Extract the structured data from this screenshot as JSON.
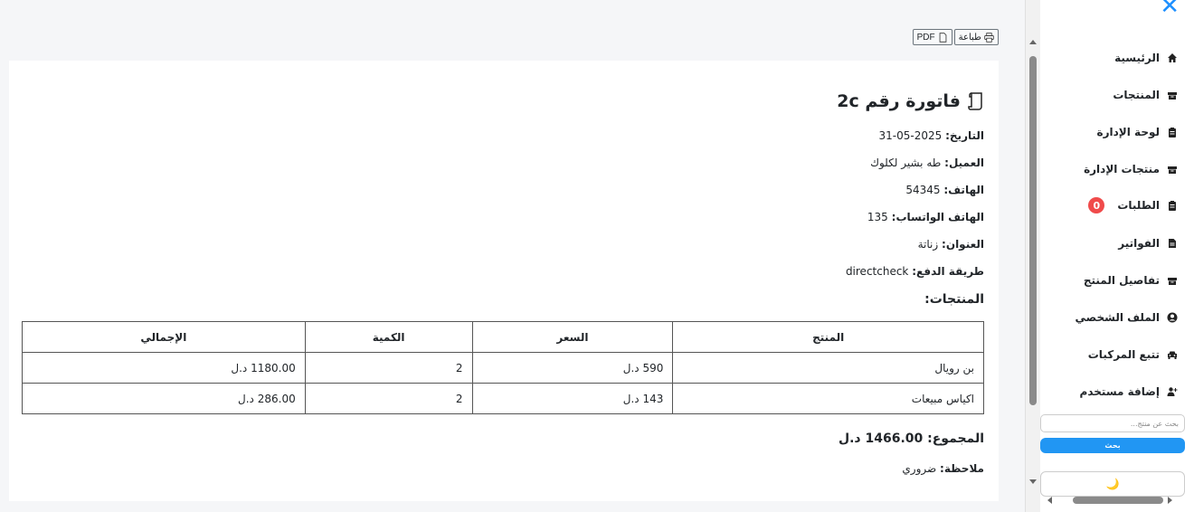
{
  "toolbar": {
    "print_label": "طباعة",
    "pdf_label": "PDF"
  },
  "invoice": {
    "title": "فاتورة رقم 2c",
    "fields": [
      {
        "label": "التاريخ:",
        "value": "2025-05-31"
      },
      {
        "label": "العميل:",
        "value": "طه بشير لكلوك"
      },
      {
        "label": "الهاتف:",
        "value": "54345"
      },
      {
        "label": "الهاتف الواتساب:",
        "value": "135"
      },
      {
        "label": "العنوان:",
        "value": "زناتة"
      },
      {
        "label": "طريقة الدفع:",
        "value": "directcheck"
      }
    ],
    "products_heading": "المنتجات:",
    "table": {
      "headers": [
        "المنتج",
        "السعر",
        "الكمية",
        "الإجمالي"
      ],
      "rows": [
        [
          "بن رويال",
          "590 د.ل",
          "2",
          "1180.00 د.ل"
        ],
        [
          "اكياس مبيعات",
          "143 د.ل",
          "2",
          "286.00 د.ل"
        ]
      ]
    },
    "total_label": "المجموع:",
    "total_value": "1466.00 د.ل",
    "note_label": "ملاحظة:",
    "note_value": "ضروري"
  },
  "sidebar": {
    "close_icon": "✕",
    "items": [
      {
        "label": "الرئيسية",
        "icon": "home-icon"
      },
      {
        "label": "المنتجات",
        "icon": "box-icon"
      },
      {
        "label": "لوحة الإدارة",
        "icon": "clipboard-icon"
      },
      {
        "label": "منتجات الإدارة",
        "icon": "box-icon"
      },
      {
        "label": "الطلبات",
        "icon": "clipboard-icon",
        "badge": "0"
      },
      {
        "label": "الفواتير",
        "icon": "file-icon"
      },
      {
        "label": "تفاصيل المنتج",
        "icon": "box-icon"
      },
      {
        "label": "الملف الشخصي",
        "icon": "user-circle-icon"
      },
      {
        "label": "تتبع المركبات",
        "icon": "car-icon"
      },
      {
        "label": "إضافة مستخدم",
        "icon": "user-plus-icon"
      }
    ],
    "search_placeholder": "بحث عن منتج...",
    "search_button": "بحث",
    "theme_icon": "🌙"
  },
  "colors": {
    "accent": "#2196f3",
    "badge": "#f04b4b",
    "close": "#1e90ff"
  }
}
